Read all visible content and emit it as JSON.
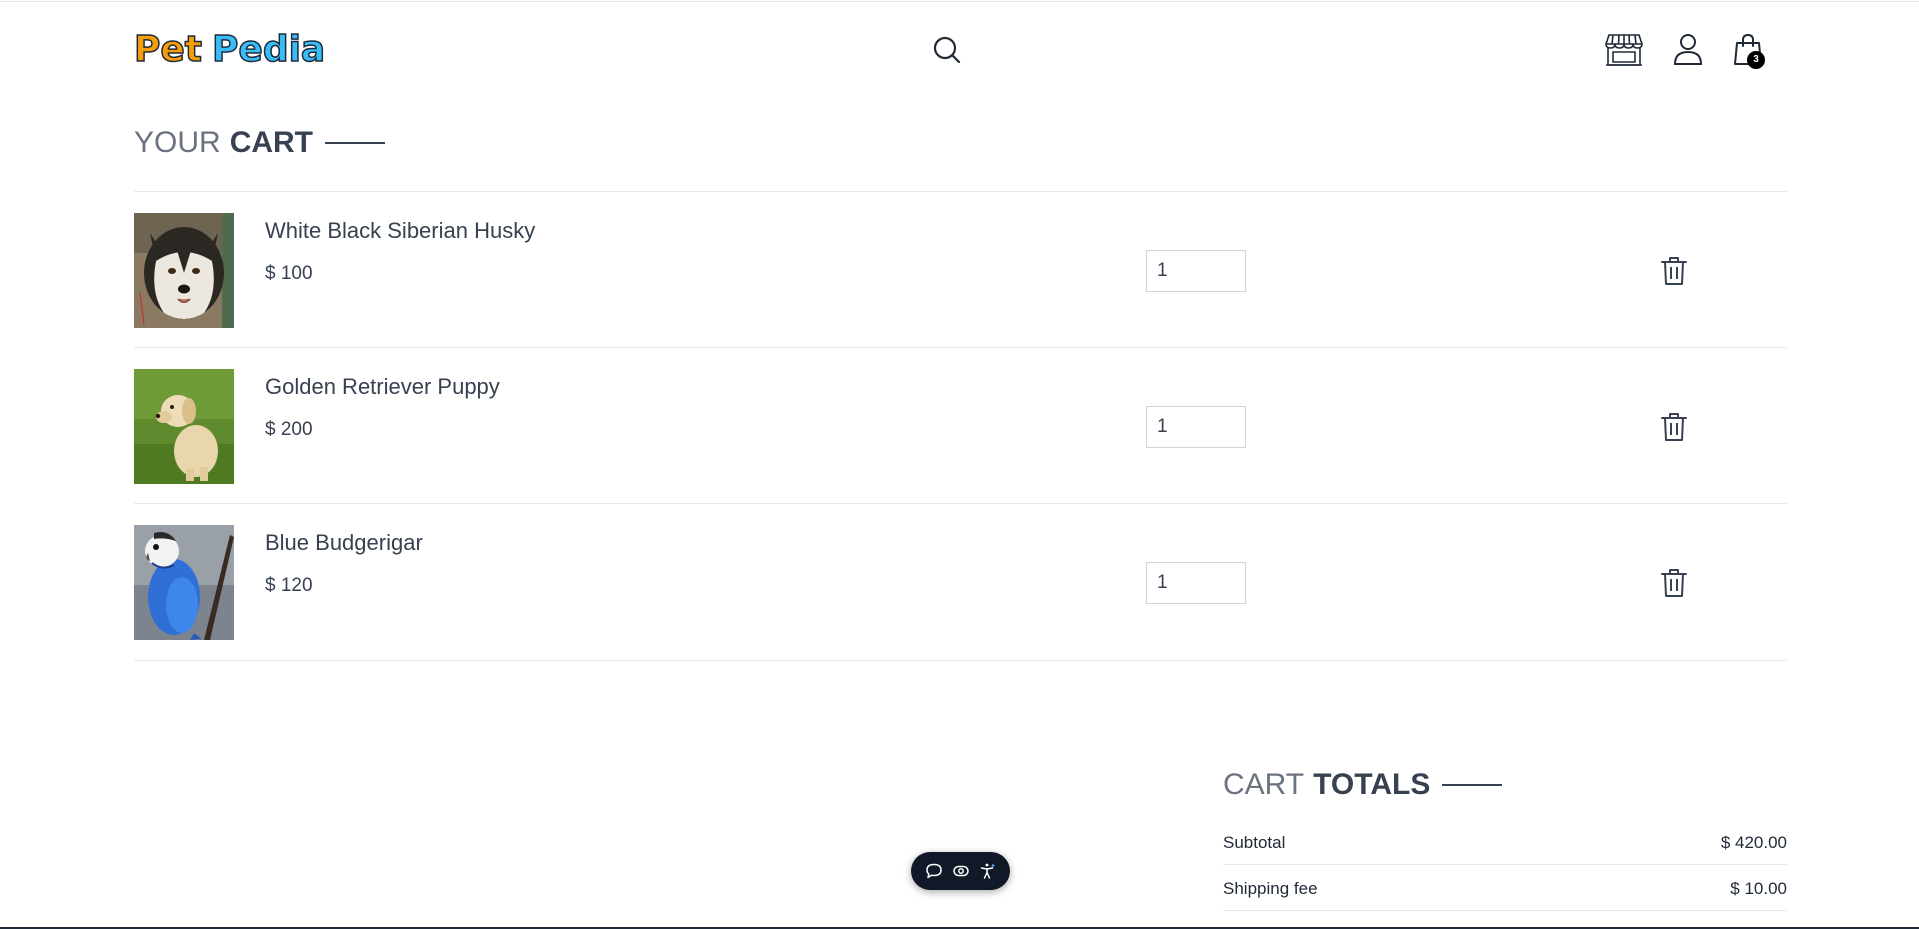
{
  "header": {
    "logo": {
      "part1": "Pet",
      "part2": "Pedia"
    },
    "cart_count": "3"
  },
  "cart_section": {
    "title_light": "YOUR",
    "title_bold": "CART",
    "items": [
      {
        "name": "White Black Siberian Husky",
        "price": "$ 100",
        "quantity": "1"
      },
      {
        "name": "Golden Retriever Puppy",
        "price": "$ 200",
        "quantity": "1"
      },
      {
        "name": "Blue Budgerigar",
        "price": "$ 120",
        "quantity": "1"
      }
    ]
  },
  "totals_section": {
    "title_light": "CART",
    "title_bold": "TOTALS",
    "rows": [
      {
        "label": "Subtotal",
        "value": "$ 420.00"
      },
      {
        "label": "Shipping fee",
        "value": "$ 10.00"
      }
    ]
  },
  "icons": {
    "search": "search-icon",
    "shop": "shop-icon",
    "user": "user-icon",
    "bag": "shopping-bag-icon",
    "delete": "trash-icon",
    "chat": "chat-icon",
    "eye": "eye-icon",
    "accessibility": "accessibility-icon"
  },
  "colors": {
    "logo_pet": "#f59e0b",
    "logo_pedia": "#38bdf8",
    "text_dark": "#374151",
    "text_light": "#6b7280",
    "divider": "#e5e7eb"
  }
}
